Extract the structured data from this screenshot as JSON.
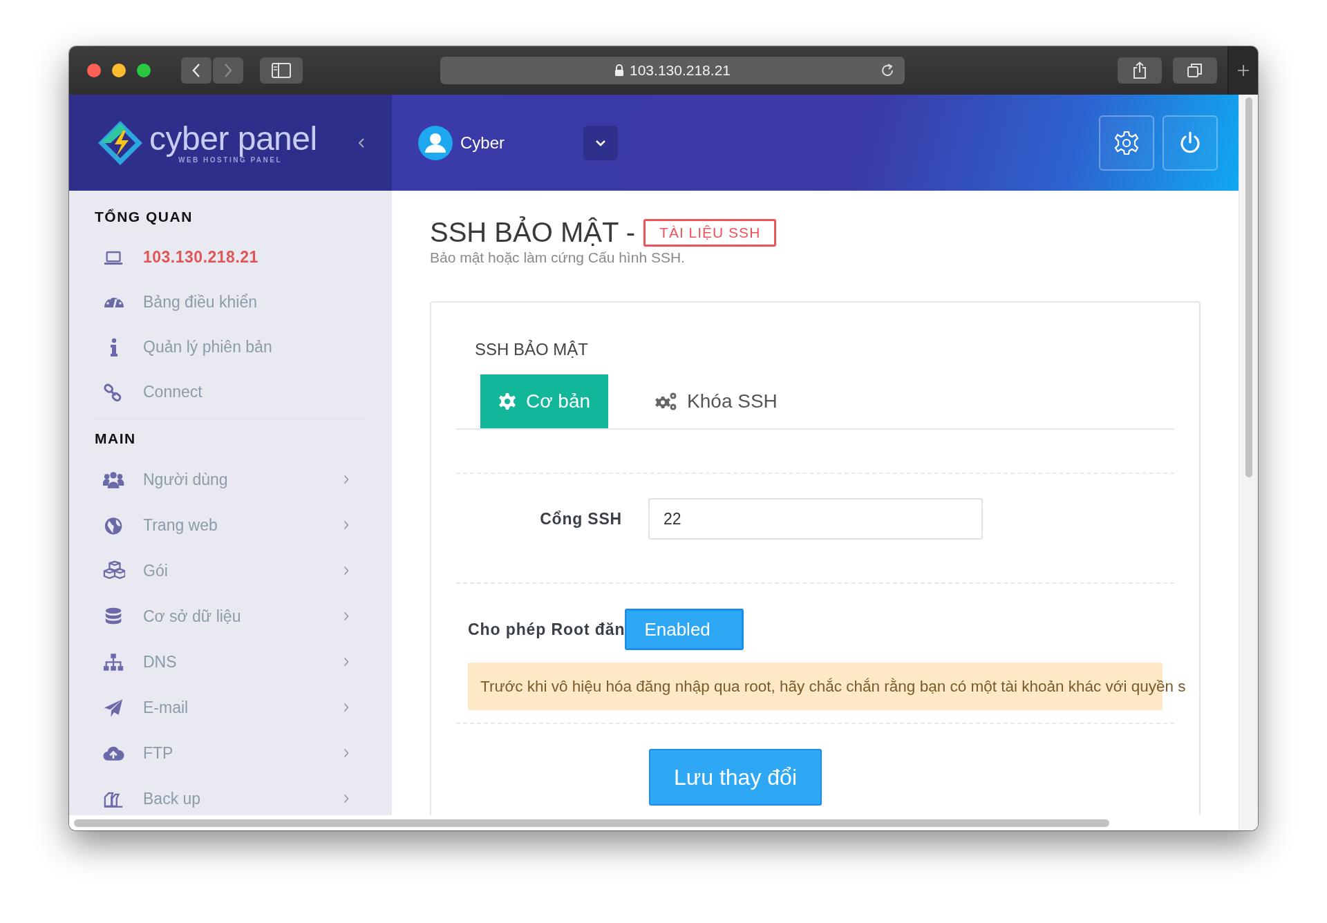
{
  "browser": {
    "url": "103.130.218.21"
  },
  "header": {
    "logo_text": "cyber panel",
    "logo_tagline": "WEB HOSTING PANEL",
    "user": "Cyber"
  },
  "sidebar": {
    "sections": [
      {
        "title": "TỔNG QUAN",
        "items": [
          {
            "label": "103.130.218.21",
            "selected": true,
            "expandable": false
          },
          {
            "label": "Bảng điều khiển",
            "selected": false,
            "expandable": false
          },
          {
            "label": "Quản lý phiên bản",
            "selected": false,
            "expandable": false
          },
          {
            "label": "Connect",
            "selected": false,
            "expandable": false
          }
        ]
      },
      {
        "title": "MAIN",
        "items": [
          {
            "label": "Người dùng",
            "selected": false,
            "expandable": true
          },
          {
            "label": "Trang web",
            "selected": false,
            "expandable": true
          },
          {
            "label": "Gói",
            "selected": false,
            "expandable": true
          },
          {
            "label": "Cơ sở dữ liệu",
            "selected": false,
            "expandable": true
          },
          {
            "label": "DNS",
            "selected": false,
            "expandable": true
          },
          {
            "label": "E-mail",
            "selected": false,
            "expandable": true
          },
          {
            "label": "FTP",
            "selected": false,
            "expandable": true
          },
          {
            "label": "Back up",
            "selected": false,
            "expandable": true
          }
        ]
      }
    ]
  },
  "page": {
    "title": "SSH BẢO MẬT -",
    "doc_link": "TÀI LIỆU SSH",
    "subtitle": "Bảo mật hoặc làm cứng Cấu hình SSH."
  },
  "card": {
    "heading": "SSH BẢO MẬT",
    "tabs": [
      {
        "label": "Cơ bản",
        "selected": true
      },
      {
        "label": "Khóa SSH",
        "selected": false
      }
    ],
    "port": {
      "label": "Cổng SSH",
      "value": "22"
    },
    "root_login": {
      "label": "Cho phép Root đăn",
      "value": "Enabled",
      "on": true
    },
    "warning": "Trước khi vô hiệu hóa đăng nhập qua root, hãy chắc chắn rằng bạn có một tài khoản khác với quyền s",
    "save_button": "Lưu thay đổi"
  }
}
